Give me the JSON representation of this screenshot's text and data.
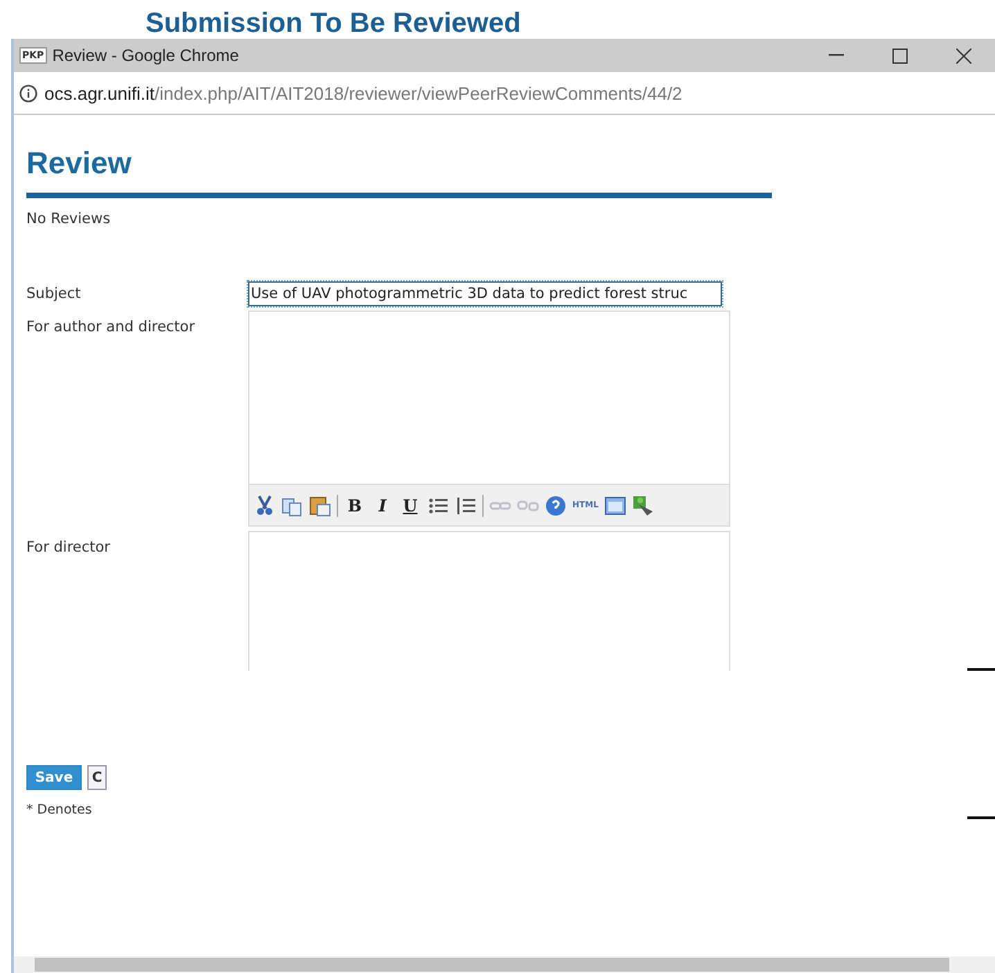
{
  "background_page": {
    "title": "Submission To Be Reviewed"
  },
  "window": {
    "favicon": "PKP",
    "title": "Review - Google Chrome"
  },
  "address_bar": {
    "host": "ocs.agr.unifi.it",
    "path": "/index.php/AIT/AIT2018/reviewer/viewPeerReviewComments/44/2"
  },
  "page": {
    "heading": "Review",
    "status": "No Reviews"
  },
  "form": {
    "subject_label": "Subject",
    "subject_value": "Use of UAV photogrammetric 3D data to predict forest struc",
    "author_label": "For author and director",
    "director_label": "For director"
  },
  "toolbar": [
    {
      "kind": "cut",
      "disabled": false
    },
    {
      "kind": "copy",
      "disabled": false
    },
    {
      "kind": "paste",
      "disabled": false
    },
    {
      "kind": "separator"
    },
    {
      "kind": "bold",
      "label": "B",
      "disabled": false
    },
    {
      "kind": "italic",
      "label": "I",
      "disabled": false
    },
    {
      "kind": "underline",
      "label": "U",
      "disabled": false
    },
    {
      "kind": "bullets",
      "disabled": false
    },
    {
      "kind": "numbers",
      "disabled": false
    },
    {
      "kind": "separator"
    },
    {
      "kind": "link",
      "disabled": true
    },
    {
      "kind": "unlink",
      "disabled": true
    },
    {
      "kind": "help",
      "disabled": false
    },
    {
      "kind": "html",
      "label": "HTML",
      "disabled": false
    },
    {
      "kind": "fullscreen",
      "disabled": false
    },
    {
      "kind": "image",
      "disabled": false
    }
  ],
  "buttons": [
    {
      "label": "Save",
      "kind": "primary"
    },
    {
      "label": "C",
      "kind": "secondary"
    }
  ],
  "note": "* Denotes"
}
